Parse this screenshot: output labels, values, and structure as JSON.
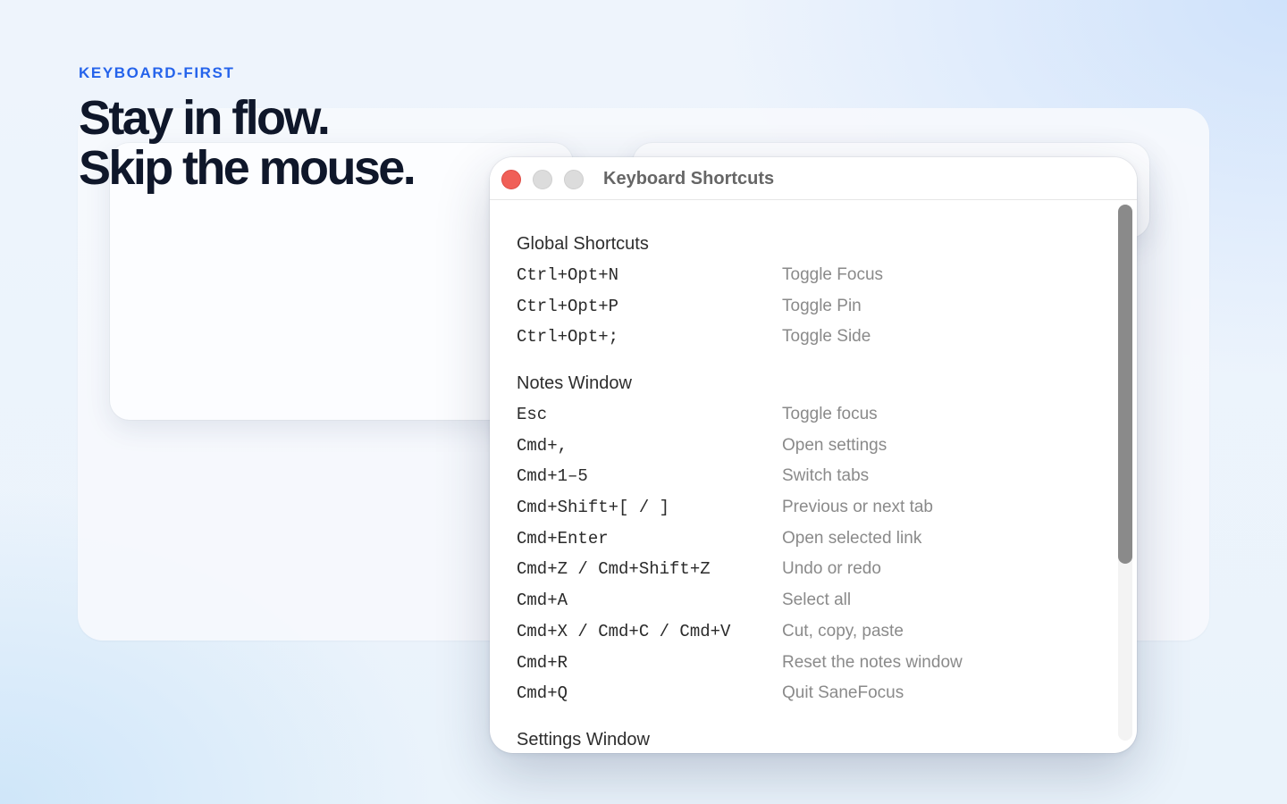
{
  "hero": {
    "eyebrow": "KEYBOARD-FIRST",
    "headline_line1": "Stay in flow.",
    "headline_line2": "Skip the mouse."
  },
  "window": {
    "title": "Keyboard Shortcuts",
    "scroll_position": 0,
    "sections": [
      {
        "title": "Global Shortcuts",
        "rows": [
          {
            "keys": "Ctrl+Opt+N",
            "action": "Toggle Focus"
          },
          {
            "keys": "Ctrl+Opt+P",
            "action": "Toggle Pin"
          },
          {
            "keys": "Ctrl+Opt+;",
            "action": "Toggle Side"
          }
        ]
      },
      {
        "title": "Notes Window",
        "rows": [
          {
            "keys": "Esc",
            "action": "Toggle focus"
          },
          {
            "keys": "Cmd+,",
            "action": "Open settings"
          },
          {
            "keys": "Cmd+1–5",
            "action": "Switch tabs"
          },
          {
            "keys": "Cmd+Shift+[ / ]",
            "action": "Previous or next tab"
          },
          {
            "keys": "Cmd+Enter",
            "action": "Open selected link"
          },
          {
            "keys": "Cmd+Z / Cmd+Shift+Z",
            "action": "Undo or redo"
          },
          {
            "keys": "Cmd+A",
            "action": "Select all"
          },
          {
            "keys": "Cmd+X / Cmd+C / Cmd+V",
            "action": "Cut, copy, paste"
          },
          {
            "keys": "Cmd+R",
            "action": "Reset the notes window"
          },
          {
            "keys": "Cmd+Q",
            "action": "Quit SaneFocus"
          }
        ]
      },
      {
        "title": "Settings Window",
        "rows": []
      }
    ]
  },
  "colors": {
    "accent": "#2563eb",
    "headline": "#0f172a",
    "close_button": "#f05f57",
    "inactive_button": "#dcdcdc",
    "key_text": "#2a2a2a",
    "action_text": "#8a8a8a"
  }
}
